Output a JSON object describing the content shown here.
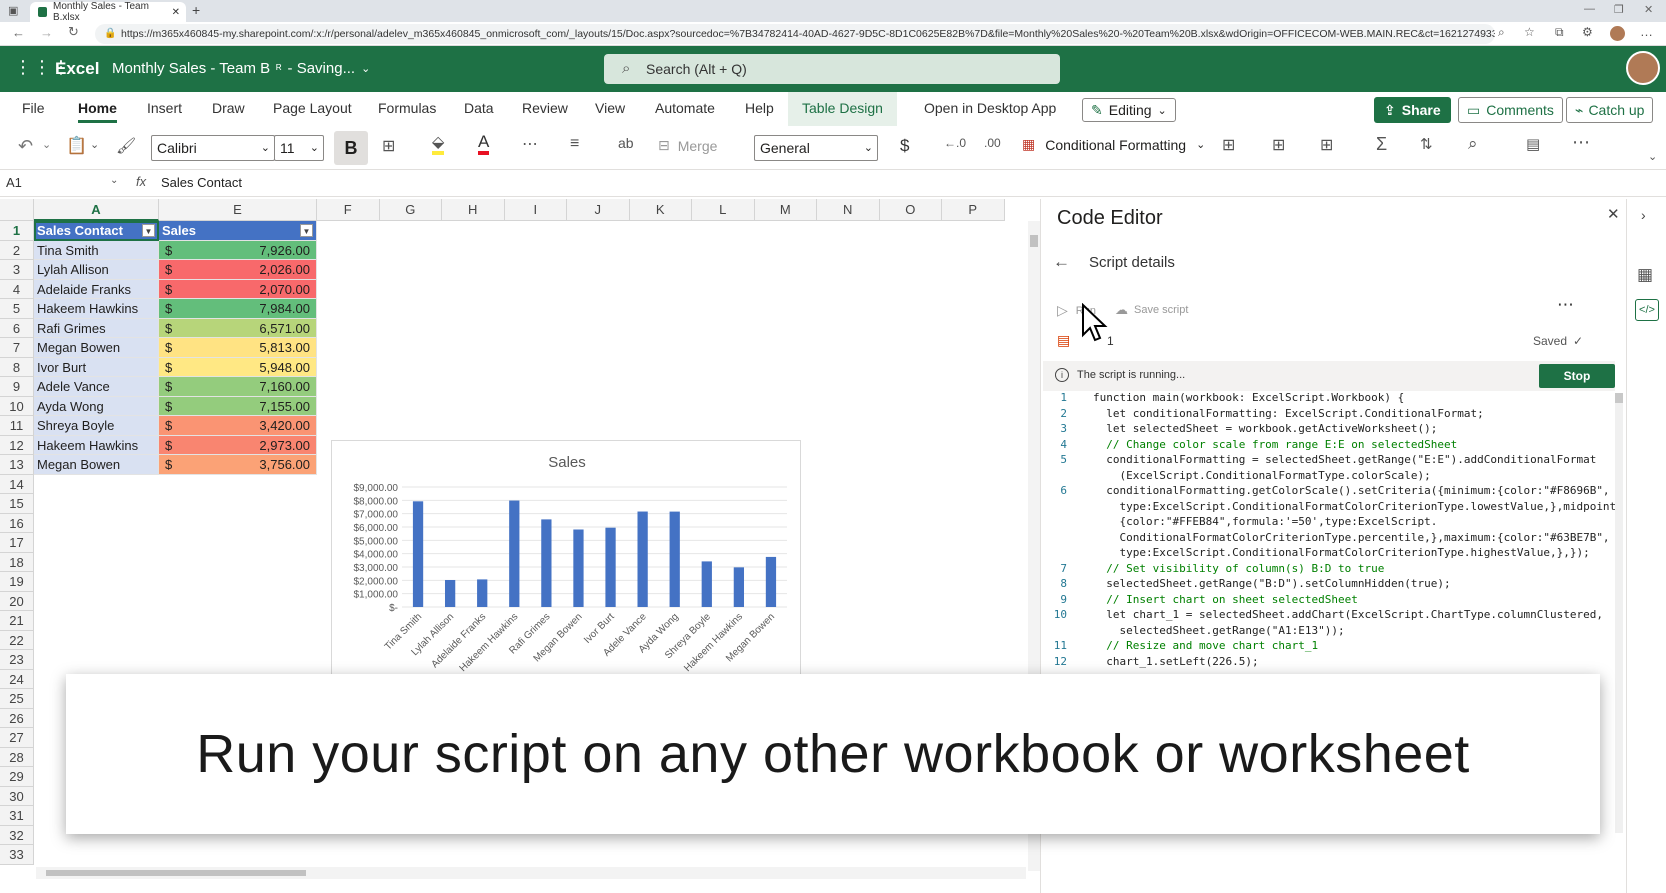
{
  "browser": {
    "tab_title": "Monthly Sales - Team B.xlsx",
    "url": "https://m365x460845-my.sharepoint.com/:x:/r/personal/adelev_m365x460845_onmicrosoft_com/_layouts/15/Doc.aspx?sourcedoc=%7B34782414-40AD-4627-9D5C-8D1C0625E82B%7D&file=Monthly%20Sales%20-%20Team%20B.xlsx&wdOrigin=OFFICECOM-WEB.MAIN.REC&ct=1621274933053..."
  },
  "app": {
    "name": "Excel",
    "doc_title": "Monthly Sales - Team B",
    "saving": "- Saving...",
    "search_placeholder": "Search (Alt + Q)"
  },
  "ribbon": {
    "tabs": [
      "File",
      "Home",
      "Insert",
      "Draw",
      "Page Layout",
      "Formulas",
      "Data",
      "Review",
      "View",
      "Automate",
      "Help",
      "Table Design"
    ],
    "open_desktop": "Open in Desktop App",
    "editing": "Editing",
    "share": "Share",
    "comments": "Comments",
    "catchup": "Catch up"
  },
  "toolbar": {
    "font": "Calibri",
    "size": "11",
    "bold": "B",
    "merge": "Merge",
    "number_format": "General",
    "currency": "$",
    "conditional": "Conditional Formatting"
  },
  "formula_bar": {
    "cell_ref": "A1",
    "fx": "fx",
    "value": "Sales Contact"
  },
  "grid": {
    "columns": [
      "A",
      "E",
      "F",
      "G",
      "H",
      "I",
      "J",
      "K",
      "L",
      "M",
      "N",
      "O",
      "P"
    ],
    "rows": [
      "1",
      "2",
      "3",
      "4",
      "5",
      "6",
      "7",
      "8",
      "9",
      "10",
      "11",
      "12",
      "13",
      "14",
      "15",
      "16",
      "17",
      "18",
      "19",
      "20",
      "21",
      "22",
      "23",
      "24",
      "25",
      "26",
      "27",
      "28",
      "29",
      "30",
      "31",
      "32",
      "33"
    ],
    "header_a": "Sales Contact",
    "header_e": "Sales",
    "data": [
      {
        "name": "Tina Smith",
        "cur": "$",
        "value": "7,926.00",
        "color": "#63be7b"
      },
      {
        "name": "Lylah Allison",
        "cur": "$",
        "value": "2,026.00",
        "color": "#f8696b"
      },
      {
        "name": "Adelaide Franks",
        "cur": "$",
        "value": "2,070.00",
        "color": "#f8696b"
      },
      {
        "name": "Hakeem Hawkins",
        "cur": "$",
        "value": "7,984.00",
        "color": "#63be7b"
      },
      {
        "name": "Rafi Grimes",
        "cur": "$",
        "value": "6,571.00",
        "color": "#b7d57a"
      },
      {
        "name": "Megan Bowen",
        "cur": "$",
        "value": "5,813.00",
        "color": "#ffe383"
      },
      {
        "name": "Ivor Burt",
        "cur": "$",
        "value": "5,948.00",
        "color": "#ffe884"
      },
      {
        "name": "Adele Vance",
        "cur": "$",
        "value": "7,160.00",
        "color": "#94cc7d"
      },
      {
        "name": "Ayda Wong",
        "cur": "$",
        "value": "7,155.00",
        "color": "#94cc7d"
      },
      {
        "name": "Shreya Boyle",
        "cur": "$",
        "value": "3,420.00",
        "color": "#fa9473"
      },
      {
        "name": "Hakeem Hawkins",
        "cur": "$",
        "value": "2,973.00",
        "color": "#f98570"
      },
      {
        "name": "Megan Bowen",
        "cur": "$",
        "value": "3,756.00",
        "color": "#fba276"
      }
    ]
  },
  "chart_data": {
    "type": "bar",
    "title": "Sales",
    "categories": [
      "Tina Smith",
      "Lylah Allison",
      "Adelaide Franks",
      "Hakeem Hawkins",
      "Rafi Grimes",
      "Megan Bowen",
      "Ivor Burt",
      "Adele Vance",
      "Ayda Wong",
      "Shreya Boyle",
      "Hakeem Hawkins",
      "Megan Bowen"
    ],
    "series": [
      {
        "name": "Sales",
        "values": [
          7926,
          2026,
          2070,
          7984,
          6571,
          5813,
          5948,
          7160,
          7155,
          3420,
          2973,
          3756
        ]
      }
    ],
    "y_ticks": [
      "$9,000.00",
      "$8,000.00",
      "$7,000.00",
      "$6,000.00",
      "$5,000.00",
      "$4,000.00",
      "$3,000.00",
      "$2,000.00",
      "$1,000.00",
      "$-"
    ],
    "ylim": [
      0,
      9000
    ],
    "legend": "Sales",
    "color": "#4472c4"
  },
  "editor": {
    "title": "Code Editor",
    "subtitle": "Script details",
    "run": "Run",
    "save": "Save script",
    "script_name": "1",
    "saved": "Saved",
    "running": "The script is running...",
    "stop": "Stop",
    "lines": [
      {
        "n": "1",
        "t": "function main(workbook: ExcelScript.Workbook) {"
      },
      {
        "n": "2",
        "t": "  let conditionalFormatting: ExcelScript.ConditionalFormat;"
      },
      {
        "n": "3",
        "t": "  let selectedSheet = workbook.getActiveWorksheet();"
      },
      {
        "n": "4",
        "t": "  // Change color scale from range E:E on selectedSheet"
      },
      {
        "n": "5",
        "t": "  conditionalFormatting = selectedSheet.getRange(\"E:E\").addConditionalFormat"
      },
      {
        "n": "",
        "t": "    (ExcelScript.ConditionalFormatType.colorScale);"
      },
      {
        "n": "6",
        "t": "  conditionalFormatting.getColorScale().setCriteria({minimum:{color:\"#F8696B\","
      },
      {
        "n": "",
        "t": "    type:ExcelScript.ConditionalFormatColorCriterionType.lowestValue,},midpoint:"
      },
      {
        "n": "",
        "t": "    {color:\"#FFEB84\",formula:'=50',type:ExcelScript."
      },
      {
        "n": "",
        "t": "    ConditionalFormatColorCriterionType.percentile,},maximum:{color:\"#63BE7B\","
      },
      {
        "n": "",
        "t": "    type:ExcelScript.ConditionalFormatColorCriterionType.highestValue,},});"
      },
      {
        "n": "7",
        "t": "  // Set visibility of column(s) B:D to true"
      },
      {
        "n": "8",
        "t": "  selectedSheet.getRange(\"B:D\").setColumnHidden(true);"
      },
      {
        "n": "9",
        "t": "  // Insert chart on sheet selectedSheet"
      },
      {
        "n": "10",
        "t": "  let chart_1 = selectedSheet.addChart(ExcelScript.ChartType.columnClustered,"
      },
      {
        "n": "",
        "t": "    selectedSheet.getRange(\"A1:E13\"));"
      },
      {
        "n": "11",
        "t": "  // Resize and move chart chart_1"
      },
      {
        "n": "12",
        "t": "  chart_1.setLeft(226.5);"
      }
    ]
  },
  "caption": "Run your script on any other workbook or worksheet"
}
